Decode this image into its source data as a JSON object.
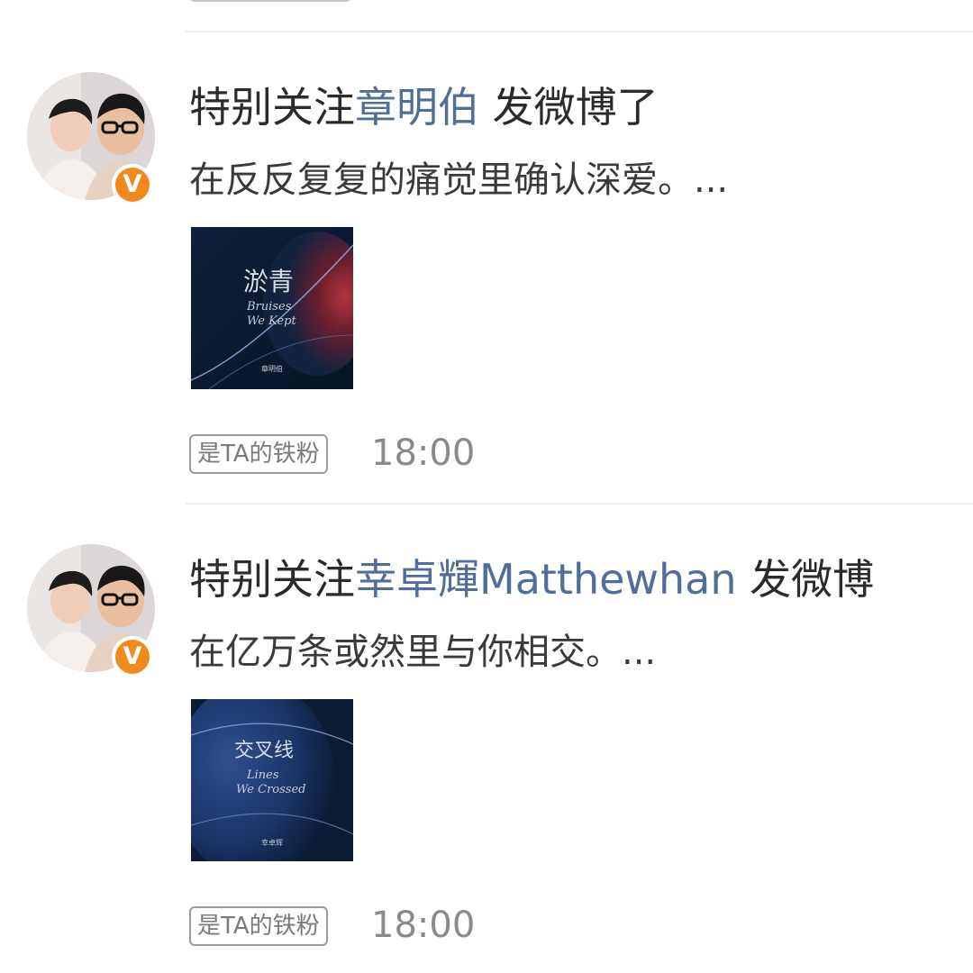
{
  "posts": [
    {
      "prefix": "特别关注",
      "username": "章明伯",
      "action": " 发微博了",
      "text": "在反反复复的痛觉里确认深爱。...",
      "cover": {
        "title": "淤青",
        "subtitle1": "Bruises",
        "subtitle2": "We Kept",
        "artist": "章明伯"
      },
      "fan_badge": "是TA的铁粉",
      "time": "18:00"
    },
    {
      "prefix": "特别关注",
      "username": "幸卓輝Matthewhan",
      "action": " 发微博",
      "text": "在亿万条或然里与你相交。...",
      "cover": {
        "title": "交叉线",
        "subtitle1": "Lines",
        "subtitle2": "We Crossed",
        "artist": "幸卓辉"
      },
      "fan_badge": "是TA的铁粉",
      "time": "18:00"
    }
  ],
  "verified_badge": "V",
  "colors": {
    "username": "#4f6f9a",
    "text": "#2b2b2b",
    "muted": "#8a8a8a",
    "badge": "#f08a1c"
  }
}
